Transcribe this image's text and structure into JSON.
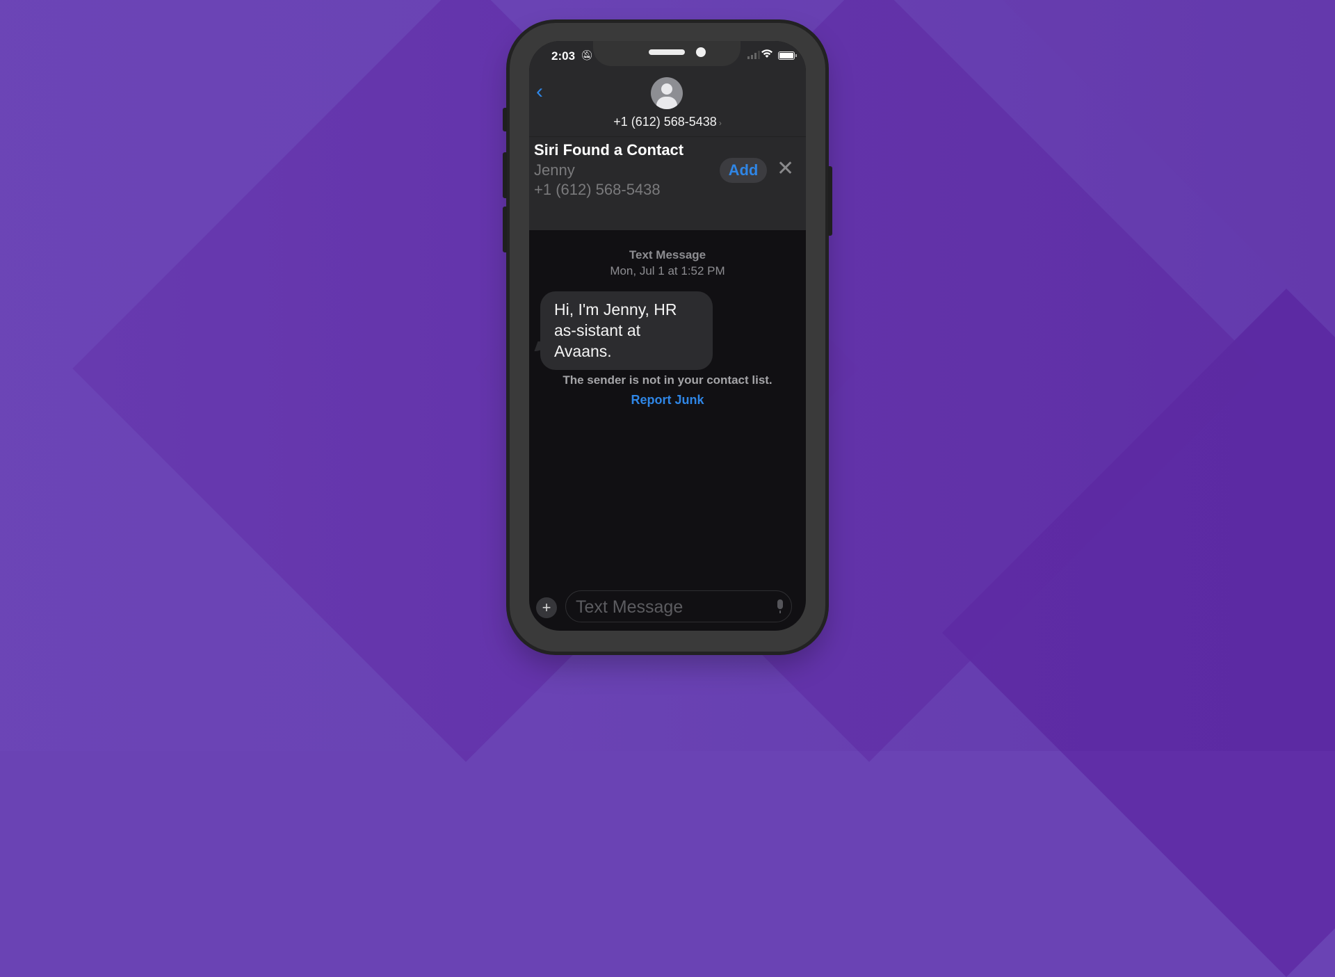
{
  "status_bar": {
    "time": "2:03",
    "silent_icon": "bell-slash-icon",
    "signal_icon": "cellular-signal-icon",
    "wifi_icon": "wifi-icon",
    "battery_icon": "battery-icon"
  },
  "header": {
    "back_icon": "chevron-left-icon",
    "back_glyph": "‹",
    "avatar_icon": "person-avatar-icon",
    "contact_number": "+1 (612) 568-5438",
    "chevron_glyph": "›"
  },
  "siri_suggestion": {
    "title": "Siri Found a Contact",
    "name": "Jenny",
    "phone": "+1 (612) 568-5438",
    "add_label": "Add",
    "close_glyph": "✕"
  },
  "conversation": {
    "service_label": "Text Message",
    "timestamp": "Mon, Jul 1 at 1:52 PM",
    "messages": [
      {
        "direction": "incoming",
        "text": "Hi, I'm Jenny, HR as-sistant at Avaans."
      }
    ],
    "notice": "The sender is not in your contact list.",
    "report_junk_label": "Report Junk"
  },
  "composer": {
    "plus_glyph": "+",
    "placeholder": "Text Message",
    "value": "",
    "mic_icon": "microphone-icon"
  },
  "colors": {
    "accent": "#2f86e6",
    "background": "#6a43b4",
    "bubble": "#2c2c2f"
  }
}
